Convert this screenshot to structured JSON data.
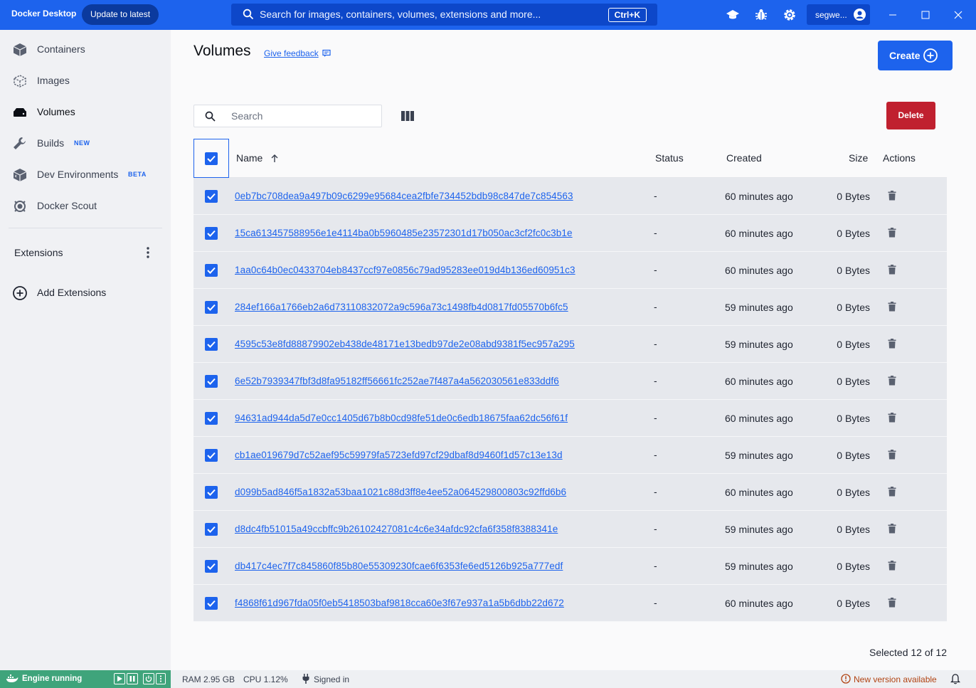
{
  "titlebar": {
    "app_name": "Docker Desktop",
    "update_label": "Update to latest",
    "search_placeholder": "Search for images, containers, volumes, extensions and more...",
    "search_shortcut": "Ctrl+K",
    "account_name": "segwe..."
  },
  "sidebar": {
    "items": [
      {
        "label": "Containers",
        "icon": "containers-icon"
      },
      {
        "label": "Images",
        "icon": "images-icon"
      },
      {
        "label": "Volumes",
        "icon": "volumes-icon"
      },
      {
        "label": "Builds",
        "icon": "builds-icon",
        "badge": "NEW"
      },
      {
        "label": "Dev Environments",
        "icon": "dev-environments-icon",
        "badge": "BETA"
      },
      {
        "label": "Docker Scout",
        "icon": "docker-scout-icon"
      }
    ],
    "extensions_label": "Extensions",
    "add_extensions_label": "Add Extensions"
  },
  "main": {
    "title": "Volumes",
    "feedback_label": "Give feedback",
    "create_label": "Create",
    "search_placeholder": "Search",
    "delete_label": "Delete",
    "columns": {
      "name": "Name",
      "status": "Status",
      "created": "Created",
      "size": "Size",
      "actions": "Actions"
    },
    "rows": [
      {
        "name": "0eb7bc708dea9a497b09c6299e95684cea2fbfe734452bdb98c847de7c854563",
        "status": "-",
        "created": "60 minutes ago",
        "size": "0 Bytes"
      },
      {
        "name": "15ca613457588956e1e4114ba0b5960485e23572301d17b050ac3cf2fc0c3b1e",
        "status": "-",
        "created": "60 minutes ago",
        "size": "0 Bytes"
      },
      {
        "name": "1aa0c64b0ec0433704eb8437ccf97e0856c79ad95283ee019d4b136ed60951c3",
        "status": "-",
        "created": "60 minutes ago",
        "size": "0 Bytes"
      },
      {
        "name": "284ef166a1766eb2a6d73110832072a9c596a73c1498fb4d0817fd05570b6fc5",
        "status": "-",
        "created": "59 minutes ago",
        "size": "0 Bytes"
      },
      {
        "name": "4595c53e8fd88879902eb438de48171e13bedb97de2e08abd9381f5ec957a295",
        "status": "-",
        "created": "59 minutes ago",
        "size": "0 Bytes"
      },
      {
        "name": "6e52b7939347fbf3d8fa95182ff56661fc252ae7f487a4a562030561e833ddf6",
        "status": "-",
        "created": "60 minutes ago",
        "size": "0 Bytes"
      },
      {
        "name": "94631ad944da5d7e0cc1405d67b8b0cd98fe51de0c6edb18675faa62dc56f61f",
        "status": "-",
        "created": "60 minutes ago",
        "size": "0 Bytes"
      },
      {
        "name": "cb1ae019679d7c52aef95c59979fa5723efd97cf29dbaf8d9460f1d57c13e13d",
        "status": "-",
        "created": "59 minutes ago",
        "size": "0 Bytes"
      },
      {
        "name": "d099b5ad846f5a1832a53baa1021c88d3ff8e4ee52a064529800803c92ffd6b6",
        "status": "-",
        "created": "60 minutes ago",
        "size": "0 Bytes"
      },
      {
        "name": "d8dc4fb51015a49ccbffc9b26102427081c4c6e34afdc92cfa6f358f8388341e",
        "status": "-",
        "created": "59 minutes ago",
        "size": "0 Bytes"
      },
      {
        "name": "db417c4ec7f7c845860f85b80e55309230fcae6f6353fe6ed5126b925a777edf",
        "status": "-",
        "created": "59 minutes ago",
        "size": "0 Bytes"
      },
      {
        "name": "f4868f61d967fda05f0eb5418503baf9818cca60e3f67e937a1a5b6dbb22d672",
        "status": "-",
        "created": "60 minutes ago",
        "size": "0 Bytes"
      }
    ],
    "selected_text": "Selected 12 of 12"
  },
  "statusbar": {
    "engine_label": "Engine running",
    "ram": "RAM 2.95 GB",
    "cpu": "CPU 1.12%",
    "signed_in": "Signed in",
    "new_version": "New version available"
  },
  "colors": {
    "brand_blue": "#1d63ed",
    "delete_red": "#c0202f",
    "engine_green": "#3fa47b",
    "warning_orange": "#b14312"
  }
}
